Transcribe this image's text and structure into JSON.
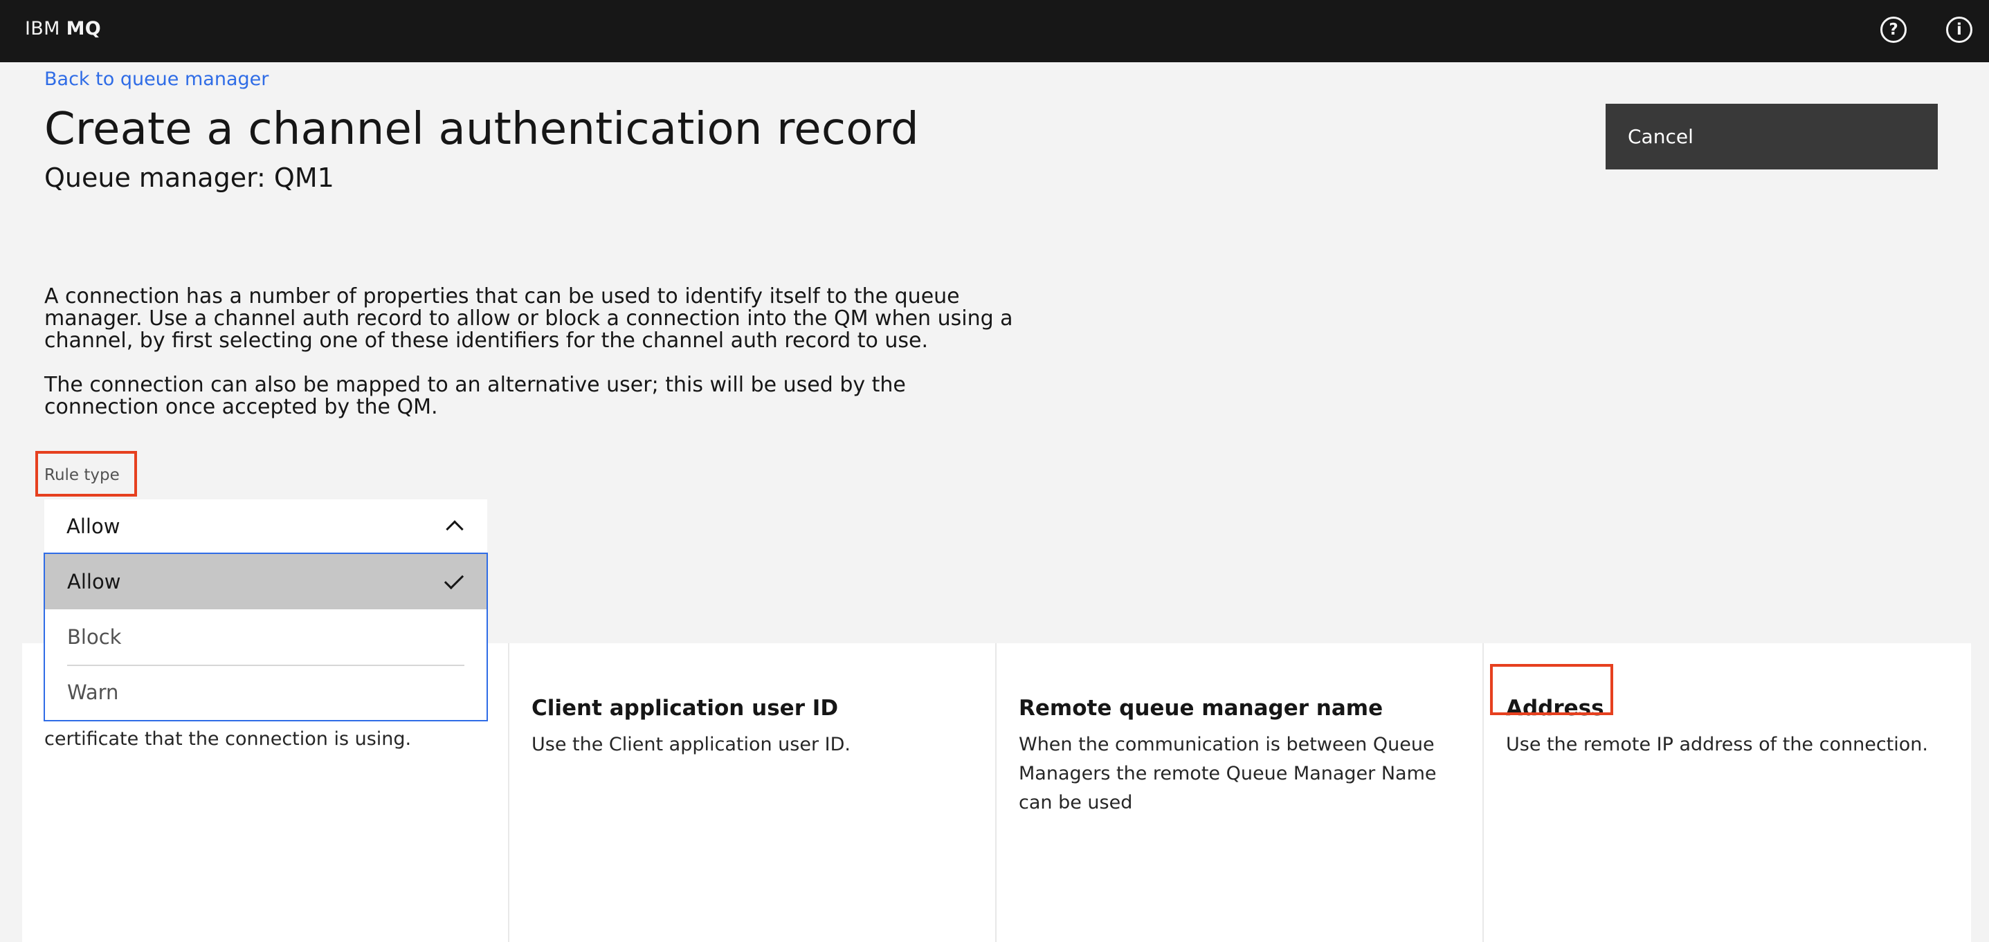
{
  "header": {
    "brand_prefix": "IBM",
    "brand_name": "MQ",
    "help_icon": "?",
    "info_icon": "i"
  },
  "nav": {
    "back_link": "Back to queue manager"
  },
  "page": {
    "title": "Create a channel authentication record",
    "subtitle": "Queue manager: QM1",
    "cancel_label": "Cancel",
    "description_1": "A connection has a number of properties that can be used to identify itself to the queue manager. Use a channel auth record to allow or block a connection into the QM when using a channel, by first selecting one of these identifiers for the channel auth record to use.",
    "description_2": "The connection can also be mapped to an alternative user; this will be used by the connection once accepted by the QM."
  },
  "rule_type": {
    "label": "Rule type",
    "selected": "Allow",
    "options": [
      "Allow",
      "Block",
      "Warn"
    ]
  },
  "cards": [
    {
      "title": "",
      "text": "Use the SSL/TLS distinguished name of the certificate that the connection is using."
    },
    {
      "title": "Client application user ID",
      "text": "Use the Client application user ID."
    },
    {
      "title": "Remote queue manager name",
      "text": "When the communication is between Queue Managers the remote Queue Manager Name can be used"
    },
    {
      "title": "Address",
      "text": "Use the remote IP address of the connection."
    }
  ],
  "colors": {
    "topbar": "#171717",
    "link": "#2f6ce6",
    "highlight": "#e6401f",
    "button": "#393939"
  }
}
